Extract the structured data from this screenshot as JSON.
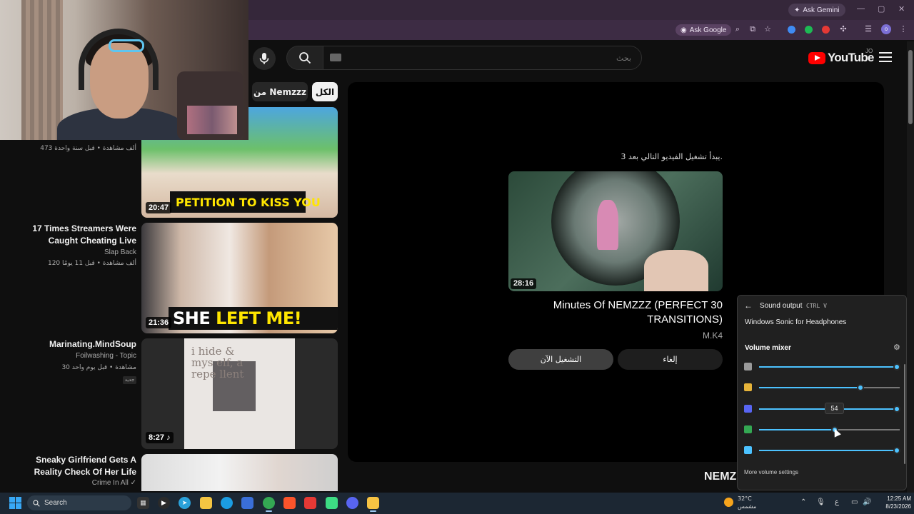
{
  "browser": {
    "gemini_label": "Ask Gemini",
    "ask_google_label": "Ask Google",
    "window_controls": [
      "—",
      "▢",
      "✕"
    ]
  },
  "youtube": {
    "search_placeholder": "بحث",
    "logo_text": "YouTube",
    "country_code": "JO",
    "chips": {
      "from_channel": "من Nemzzz",
      "all": "الكل"
    },
    "side_videos": [
      {
        "title": "",
        "channel": "",
        "meta": "473 ألف مشاهدة • قبل سنة واحدة",
        "duration": "20:47",
        "banner": "PETITION TO KISS YOU"
      },
      {
        "title": "17 Times Streamers Were Caught Cheating Live",
        "channel": "Slap Back",
        "meta": "120 ألف مشاهدة • قبل 11 يومًا",
        "duration": "21:36",
        "banner_white": "SHE ",
        "banner_yellow": "LEFT ME!"
      },
      {
        "title": "Marinating.MindSoup",
        "channel": "Foilwashing - Topic",
        "meta": "30 مشاهدة • قبل يوم واحد",
        "badge": "جديد",
        "duration": "8:27 ♪",
        "paper_text": "i hide & mys elf, a repe llent"
      },
      {
        "title": "Sneaky Girlfriend Gets A Reality Check Of Her Life",
        "channel": "Crime In All ✓"
      }
    ],
    "up_next": {
      "countdown": "يبدأ تشغيل الفيديو التالي بعد 3.",
      "duration": "28:16",
      "title": "Minutes Of NEMZZZ (PERFECT 30 TRANSITIONS)",
      "channel": "M.K4",
      "play_now": "التشغيل الآن",
      "cancel": "إلغاء"
    },
    "partial_title": "NEMZ"
  },
  "sound_flyout": {
    "title": "Sound output",
    "shortcut": "CTRL   V",
    "device": "Windows Sonic for Headphones",
    "mixer_label": "Volume mixer",
    "tooltip_value": "54",
    "more": "More volume settings",
    "sliders": [
      {
        "app": "system-speaker-icon",
        "level": 0.98,
        "color": "#9a9a9a"
      },
      {
        "app": "app-notes-icon",
        "level": 0.72,
        "color": "#e7b43a"
      },
      {
        "app": "discord-icon",
        "level": 0.98,
        "color": "#5865f2"
      },
      {
        "app": "chrome-icon",
        "level": 0.54,
        "color": "#34a853"
      },
      {
        "app": "app-window-icon",
        "level": 0.98,
        "color": "#4cc2ff"
      }
    ]
  },
  "taskbar": {
    "search_label": "Search",
    "weather_temp": "32°C",
    "weather_desc": "مشمس",
    "lang": "ع",
    "time": "12:25 AM",
    "date": "8/23/2026"
  }
}
